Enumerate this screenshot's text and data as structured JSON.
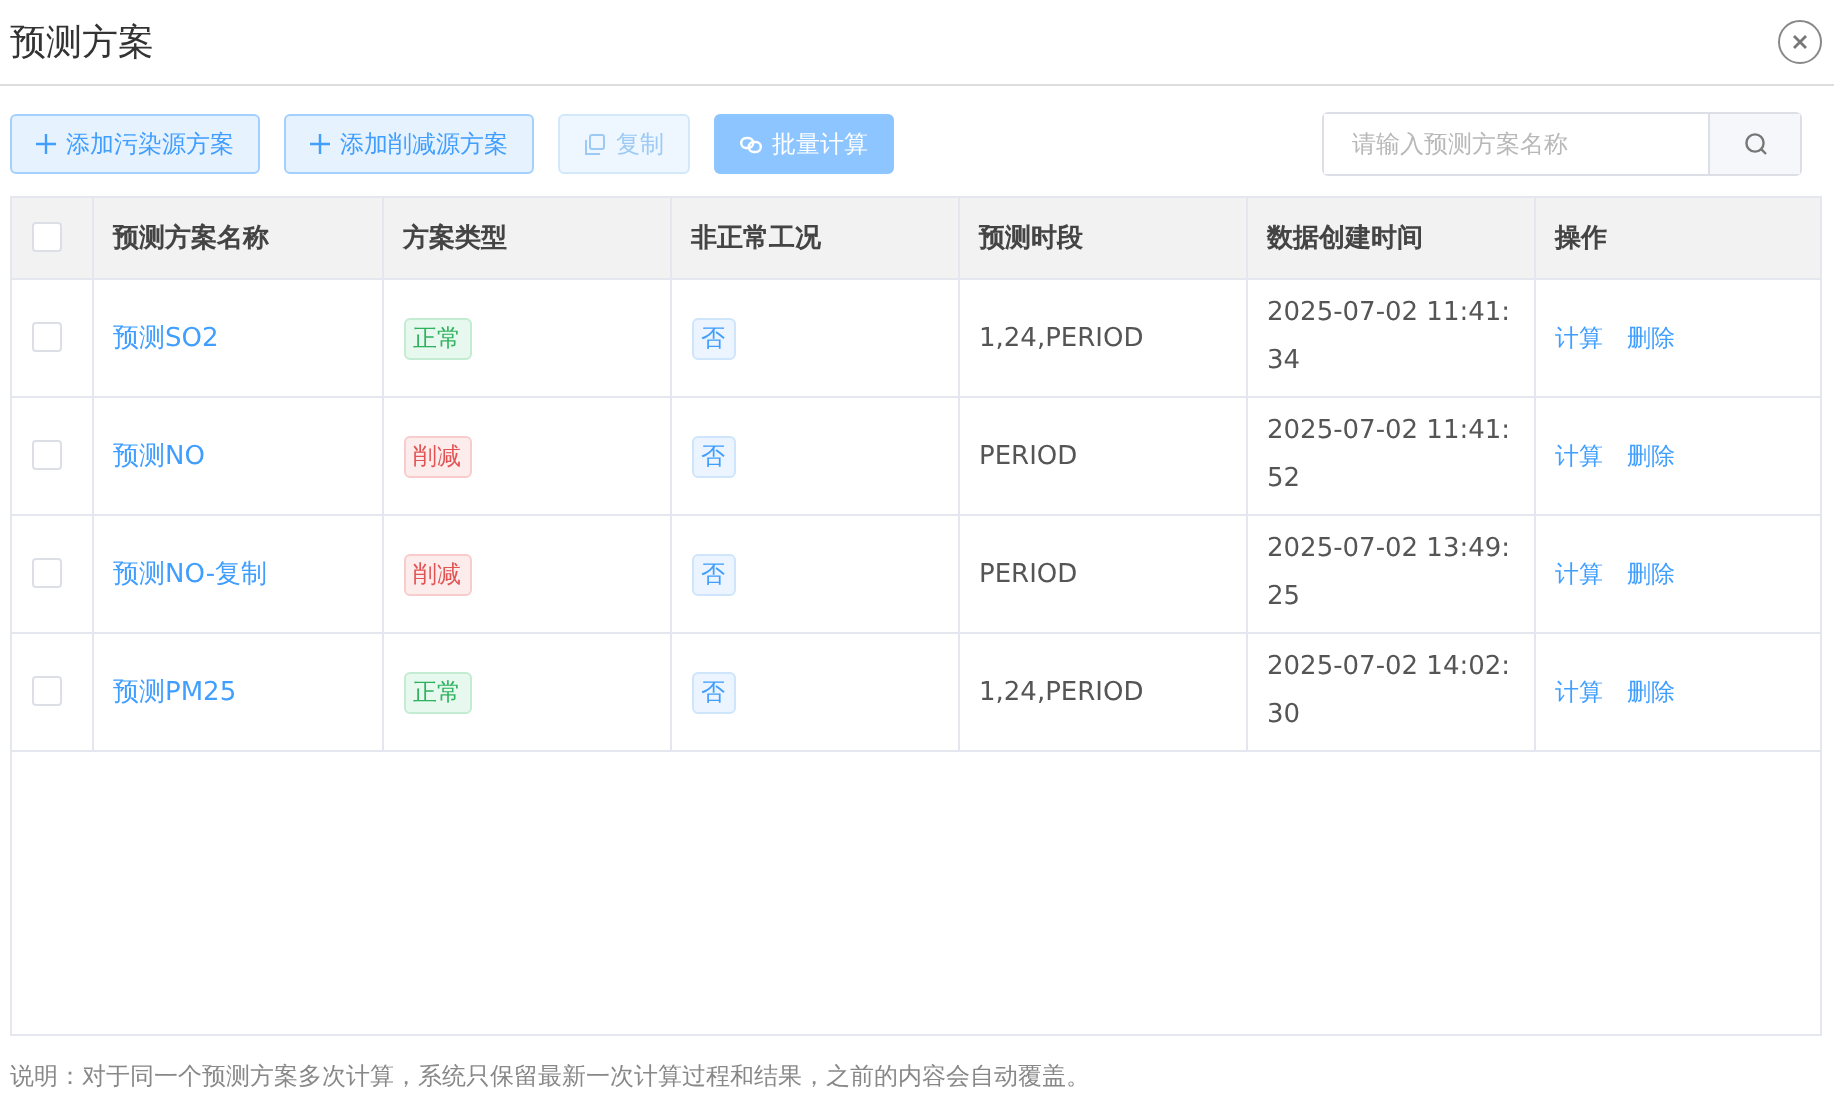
{
  "window": {
    "title": "预测方案"
  },
  "toolbar": {
    "buttons": [
      {
        "label": "添加污染源方案",
        "kind": "add",
        "disabled": false
      },
      {
        "label": "添加削减源方案",
        "kind": "add",
        "disabled": false
      },
      {
        "label": "复制",
        "kind": "copy",
        "disabled": true
      },
      {
        "label": "批量计算",
        "kind": "batch",
        "disabled": true
      }
    ],
    "search": {
      "placeholder": "请输入预测方案名称"
    }
  },
  "table": {
    "all_checked": false,
    "columns": [
      "预测方案名称",
      "方案类型",
      "非正常工况",
      "预测时段",
      "数据创建时间",
      "操作"
    ],
    "rows": [
      {
        "checked": false,
        "name": "预测SO2",
        "type": {
          "text": "正常",
          "kind": "normal"
        },
        "abnormal": "否",
        "period": "1,24,PERIOD",
        "created": "2025-07-02 11:41:34",
        "actions": [
          "计算",
          "删除"
        ]
      },
      {
        "checked": false,
        "name": "预测NO",
        "type": {
          "text": "削减",
          "kind": "reduce"
        },
        "abnormal": "否",
        "period": "PERIOD",
        "created": "2025-07-02 11:41:52",
        "actions": [
          "计算",
          "删除"
        ]
      },
      {
        "checked": false,
        "name": "预测NO-复制",
        "type": {
          "text": "削减",
          "kind": "reduce"
        },
        "abnormal": "否",
        "period": "PERIOD",
        "created": "2025-07-02 13:49:25",
        "actions": [
          "计算",
          "删除"
        ]
      },
      {
        "checked": false,
        "name": "预测PM25",
        "type": {
          "text": "正常",
          "kind": "normal"
        },
        "abnormal": "否",
        "period": "1,24,PERIOD",
        "created": "2025-07-02 14:02:30",
        "actions": [
          "计算",
          "删除"
        ]
      }
    ]
  },
  "note": "说明：对于同一个预测方案多次计算，系统只保留最新一次计算过程和结果，之前的内容会自动覆盖。"
}
